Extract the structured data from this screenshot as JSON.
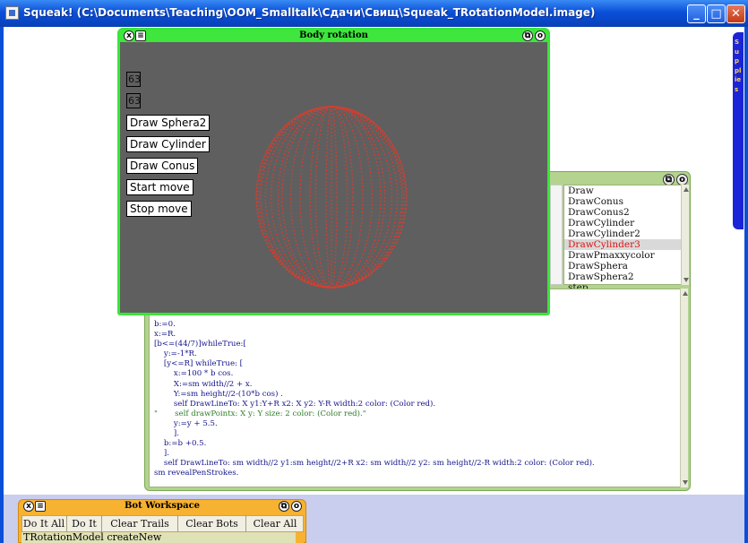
{
  "window": {
    "title": "Squeak! (C:\\Documents\\Teaching\\OOM_Smalltalk\\Сдачи\\Свищ\\Squeak_TRotationModel.image)",
    "min_glyph": "_",
    "max_glyph": "□",
    "close_glyph": "✕"
  },
  "flap": {
    "label": "Supplies"
  },
  "body_rotation": {
    "title": "Body rotation",
    "close_glyph": "x",
    "menu_glyph": "≡",
    "collapse_glyph": "⧉",
    "expand_glyph": "o",
    "num1": "63",
    "num2": "63",
    "buttons": [
      "Draw Sphera2",
      "Draw Cylinder",
      "Draw Conus",
      "Start move",
      "Stop move"
    ],
    "sphere_color": "#e23b2b"
  },
  "browser": {
    "collapse_glyph": "⧉",
    "expand_glyph": "o",
    "methods": [
      "Draw",
      "DrawConus",
      "DrawConus2",
      "DrawCylinder",
      "DrawCylinder2",
      "DrawCylinder3",
      "DrawPmaxxycolor",
      "DrawSphera",
      "DrawSphera2",
      "step"
    ],
    "selected_method": "DrawCylinder3",
    "code_lines": [
      "b:=0.",
      "x:=R.",
      "[b<=(44/7)]whileTrue:[",
      "    y:=-1*R.",
      "    [y<=R] whileTrue: [",
      "        x:=100 * b cos.",
      "        X:=sm width//2 + x.",
      "        Y:=sm height//2-(10*b cos) .",
      "        self DrawLineTo: X y1:Y+R x2: X y2: Y-R width:2 color: (Color red).",
      "\"       self drawPointx: X y: Y size: 2 color: (Color red).\"",
      "        y:=y + 5.5.",
      "        ].",
      "    b:=b +0.5.",
      "    ].",
      "    self DrawLineTo: sm width//2 y1:sm height//2+R x2: sm width//2 y2: sm height//2-R width:2 color: (Color red).",
      "sm revealPenStrokes."
    ]
  },
  "bot_workspace": {
    "title": "Bot Workspace",
    "close_glyph": "x",
    "menu_glyph": "≡",
    "collapse_glyph": "⧉",
    "expand_glyph": "o",
    "buttons": [
      "Do It All",
      "Do It",
      "Clear Trails",
      "Clear Bots",
      "Clear All"
    ],
    "input_text": "TRotationModel createNew"
  }
}
